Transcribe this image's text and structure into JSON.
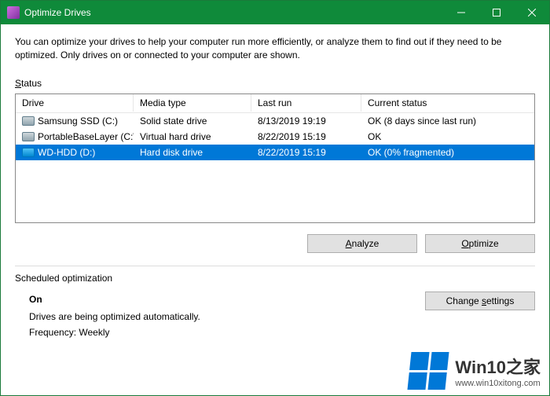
{
  "titlebar": {
    "title": "Optimize Drives"
  },
  "description": "You can optimize your drives to help your computer run more efficiently, or analyze them to find out if they need to be optimized. Only drives on or connected to your computer are shown.",
  "status_label_pre": "S",
  "status_label_post": "tatus",
  "columns": {
    "drive": "Drive",
    "media": "Media type",
    "last": "Last run",
    "status": "Current status"
  },
  "drives": [
    {
      "name": "Samsung SSD (C:)",
      "media": "Solid state drive",
      "last": "8/13/2019 19:19",
      "status": "OK (8 days since last run)",
      "selected": false,
      "icon": "ssd"
    },
    {
      "name": "PortableBaseLayer (C:\\...",
      "media": "Virtual hard drive",
      "last": "8/22/2019 15:19",
      "status": "OK",
      "selected": false,
      "icon": "vhd"
    },
    {
      "name": "WD-HDD (D:)",
      "media": "Hard disk drive",
      "last": "8/22/2019 15:19",
      "status": "OK (0% fragmented)",
      "selected": true,
      "icon": "hdd"
    }
  ],
  "buttons": {
    "analyze_pre": "",
    "analyze_u": "A",
    "analyze_post": "nalyze",
    "optimize_pre": "",
    "optimize_u": "O",
    "optimize_post": "ptimize",
    "change_pre": "Change ",
    "change_u": "s",
    "change_post": "ettings"
  },
  "scheduled": {
    "label": "Scheduled optimization",
    "on": "On",
    "desc": "Drives are being optimized automatically.",
    "freq": "Frequency: Weekly"
  },
  "watermark": {
    "big": "Win10之家",
    "small": "www.win10xitong.com"
  }
}
